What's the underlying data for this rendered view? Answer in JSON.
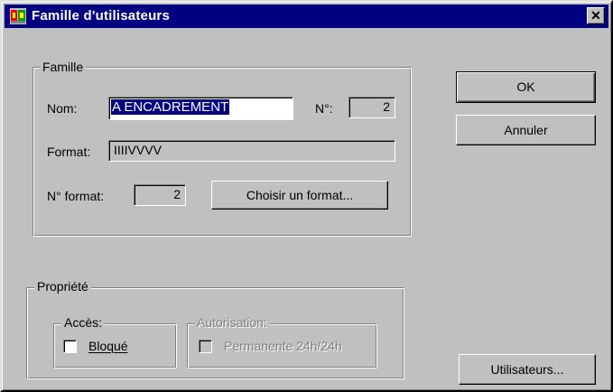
{
  "window": {
    "title": "Famille d'utilisateurs",
    "close_glyph": "✕"
  },
  "famille": {
    "legend": "Famille",
    "nom_label": "Nom:",
    "nom_value": "A ENCADREMENT",
    "numero_label": "N°:",
    "numero_value": "2",
    "format_label": "Format:",
    "format_value": "IIIIVVVV",
    "num_format_label": "N° format:",
    "num_format_value": "2",
    "choisir_button": "Choisir un format..."
  },
  "propriete": {
    "legend": "Propriété",
    "acces_legend": "Accès:",
    "bloque_label": "Bloqué",
    "bloque_checked": false,
    "autorisation_legend": "Autorisation:",
    "permanente_label": "Permanente 24h/24h",
    "permanente_checked": false
  },
  "buttons": {
    "ok": "OK",
    "annuler": "Annuler",
    "utilisateurs": "Utilisateurs..."
  },
  "colors": {
    "title_bar": "#000080",
    "face": "#c0c0c0",
    "selection": "#000080"
  }
}
